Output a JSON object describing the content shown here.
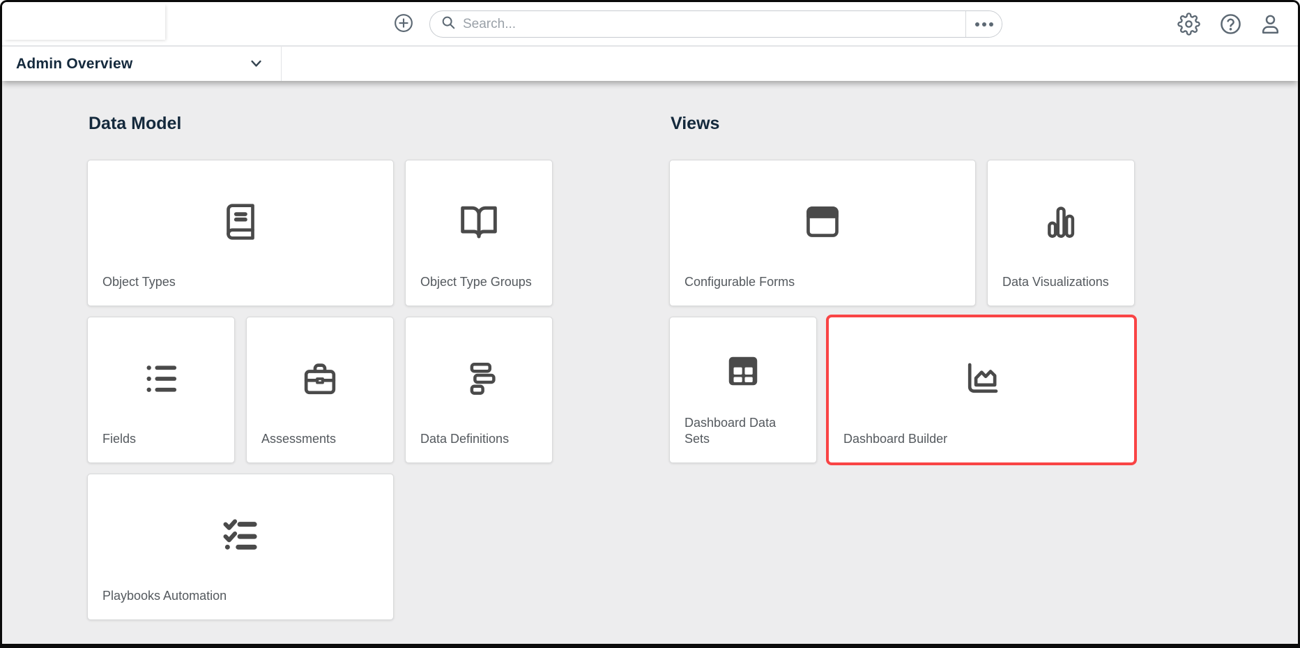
{
  "topbar": {
    "search_placeholder": "Search...",
    "search_value": "",
    "icons": [
      "plus-circle-icon",
      "search-icon",
      "ellipsis-icon",
      "gear-icon",
      "help-icon",
      "user-icon"
    ]
  },
  "header": {
    "title": "Admin Overview",
    "icon": "chevron-down-icon"
  },
  "sections": [
    {
      "title": "Data Model",
      "cards": [
        {
          "label": "Object Types",
          "icon": "book-icon",
          "wide": true
        },
        {
          "label": "Object Type Groups",
          "icon": "open-book-icon",
          "wide": false
        },
        {
          "label": "Fields",
          "icon": "list-icon",
          "wide": false
        },
        {
          "label": "Assessments",
          "icon": "briefcase-icon",
          "wide": false
        },
        {
          "label": "Data Definitions",
          "icon": "data-definitions-icon",
          "wide": false
        },
        {
          "label": "Playbooks Automation",
          "icon": "checklist-icon",
          "wide": true
        }
      ]
    },
    {
      "title": "Views",
      "cards": [
        {
          "label": "Configurable Forms",
          "icon": "window-icon",
          "wide": true
        },
        {
          "label": "Data Visualizations",
          "icon": "bar-chart-icon",
          "wide": false
        },
        {
          "label": "Dashboard Data Sets",
          "icon": "table-icon",
          "wide": false
        },
        {
          "label": "Dashboard Builder",
          "icon": "area-chart-icon",
          "wide": true,
          "highlighted": true
        }
      ]
    }
  ],
  "colors": {
    "highlight_red": "#F94445",
    "heading_navy": "#14293C",
    "topbar_icon_slate": "#5C6873",
    "card_icon_gray": "#4A4A4A",
    "content_background": "#EDEDEE"
  }
}
